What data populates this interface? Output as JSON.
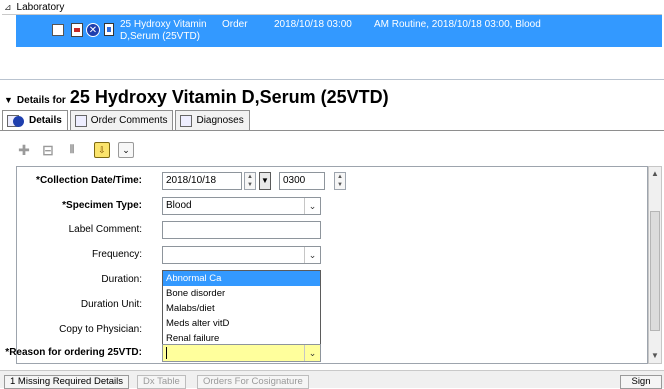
{
  "orders": {
    "section_label": "Laboratory",
    "row": {
      "name_line1": "25 Hydroxy Vitamin",
      "name_line2": "D,Serum (25VTD)",
      "action": "Order",
      "start": "2018/10/18 03:00",
      "details": "AM Routine, 2018/10/18 03:00, Blood"
    }
  },
  "details": {
    "for_label": "Details for",
    "name": "25 Hydroxy Vitamin D,Serum (25VTD)"
  },
  "tabs": [
    {
      "label": "Details"
    },
    {
      "label": "Order Comments"
    },
    {
      "label": "Diagnoses"
    }
  ],
  "form": {
    "collection": {
      "label": "*Collection Date/Time:",
      "date": "2018/10/18",
      "time": "0300"
    },
    "specimen": {
      "label": "*Specimen Type:",
      "value": "Blood"
    },
    "label_comment": {
      "label": "Label Comment:",
      "value": ""
    },
    "frequency": {
      "label": "Frequency:",
      "value": ""
    },
    "duration": {
      "label": "Duration:"
    },
    "duration_unit": {
      "label": "Duration Unit:"
    },
    "copy_to": {
      "label": "Copy to Physician:"
    },
    "reason": {
      "label": "*Reason for ordering 25VTD:",
      "value": ""
    },
    "reason_options": [
      "Abnormal Ca",
      "Bone disorder",
      "Malabs/diet",
      "Meds alter vitD",
      "Renal failure"
    ]
  },
  "bottom": {
    "missing": "1 Missing Required Details",
    "dx_table": "Dx Table",
    "cosign": "Orders For Cosignature",
    "sign": "Sign"
  },
  "colors": {
    "selection": "#3399ff",
    "required_field": "#ffff9c"
  }
}
